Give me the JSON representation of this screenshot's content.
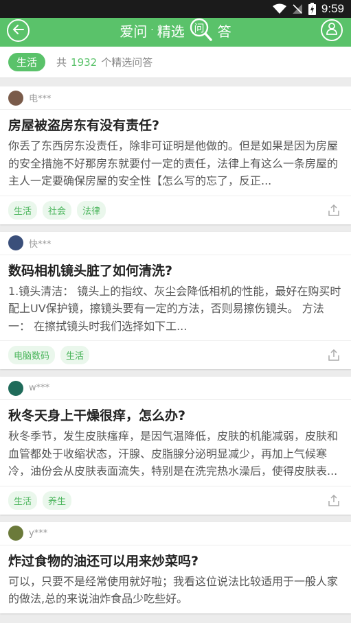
{
  "status": {
    "time": "9:59"
  },
  "header": {
    "title_left": "爱问",
    "sep": "·",
    "title_mid": "精选",
    "logo_char": "问",
    "title_right": "答"
  },
  "filter": {
    "chip": "生活",
    "prefix": "共",
    "count": "1932",
    "suffix": "个精选问答"
  },
  "cards": [
    {
      "author": "电***",
      "avatar_color": "#7a5b4a",
      "question": "房屋被盗房东有没有责任?",
      "answer": "你丢了东西房东没责任，除非可证明是他做的。但是如果是因为房屋的安全措施不好那房东就要付一定的责任，法律上有这么一条房屋的主人一定要确保房屋的安全性【怎么写的忘了，反正...",
      "tags": [
        "生活",
        "社会",
        "法律"
      ]
    },
    {
      "author": "快***",
      "avatar_color": "#3a4f7a",
      "question": "数码相机镜头脏了如何清洗?",
      "answer": "1.镜头清洁： 镜头上的指纹、灰尘会降低相机的性能，最好在购买时配上UV保护镜，擦镜头要有一定的方法，否则易擦伤镜头。 方法一： 在擦拭镜头时我们选择如下工...",
      "tags": [
        "电脑数码",
        "生活"
      ]
    },
    {
      "author": "w***",
      "avatar_color": "#1f6b5a",
      "question": "秋冬天身上干燥很痒，怎么办?",
      "answer": "秋冬季节，发生皮肤瘙痒，是因气温降低，皮肤的机能减弱，皮肤和血管都处于收缩状态，汗腺、皮脂腺分泌明显减少，再加上气候寒冷，油份会从皮肤表面流失，特别是在洗完热水澡后，使得皮肤表...",
      "tags": [
        "生活",
        "养生"
      ]
    },
    {
      "author": "y***",
      "avatar_color": "#6b7a3a",
      "question": "炸过食物的油还可以用来炒菜吗?",
      "answer": "可以，只要不是经常使用就好啦；我看这位说法比较适用于一般人家的做法,总的来说油炸食品少吃些好。",
      "tags": []
    }
  ]
}
